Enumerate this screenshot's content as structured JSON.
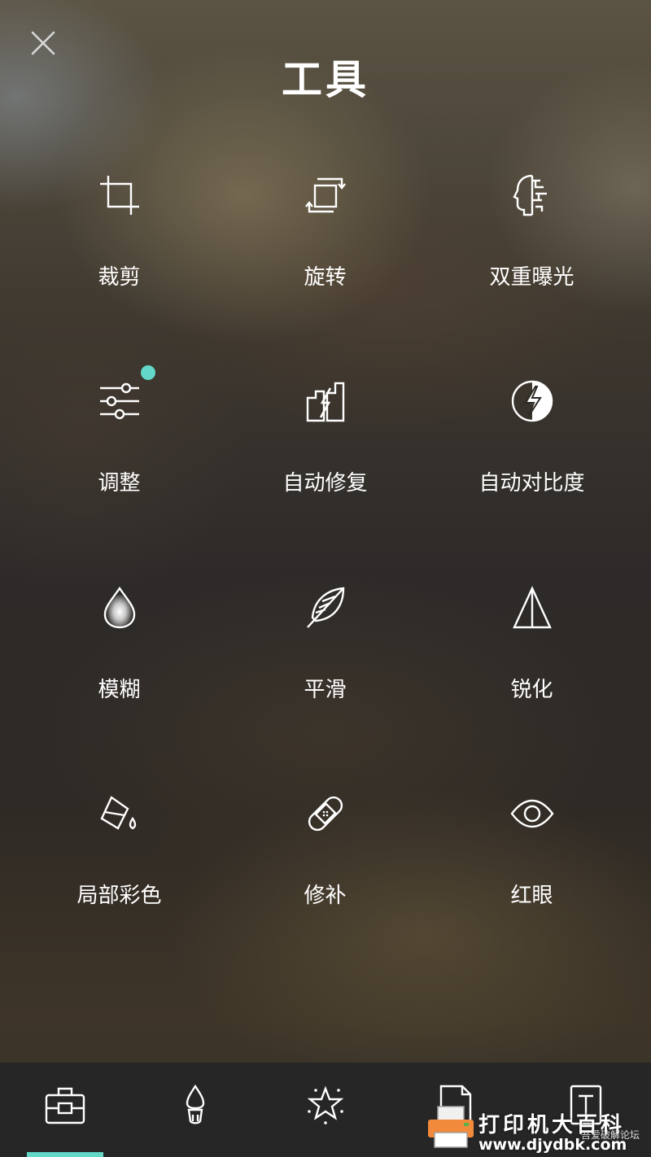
{
  "header": {
    "close_icon": "close-icon",
    "title": "工具"
  },
  "tools": [
    {
      "label": "裁剪",
      "icon": "crop-icon"
    },
    {
      "label": "旋转",
      "icon": "rotate-icon"
    },
    {
      "label": "双重曝光",
      "icon": "double-exposure-icon"
    },
    {
      "label": "调整",
      "icon": "tune-sliders-icon",
      "has_badge": true
    },
    {
      "label": "自动修复",
      "icon": "auto-fix-icon"
    },
    {
      "label": "自动对比度",
      "icon": "auto-contrast-icon"
    },
    {
      "label": "模糊",
      "icon": "blur-drop-icon"
    },
    {
      "label": "平滑",
      "icon": "feather-icon"
    },
    {
      "label": "锐化",
      "icon": "sharpen-triangle-icon"
    },
    {
      "label": "局部彩色",
      "icon": "paint-bucket-icon"
    },
    {
      "label": "修补",
      "icon": "bandage-icon"
    },
    {
      "label": "红眼",
      "icon": "eye-icon"
    }
  ],
  "bottom_tabs": [
    {
      "icon": "toolbox-icon",
      "active": true
    },
    {
      "icon": "brush-icon"
    },
    {
      "icon": "sticker-star-icon"
    },
    {
      "icon": "frame-document-icon"
    },
    {
      "icon": "text-icon"
    }
  ],
  "watermark": {
    "main": "打印机大百科",
    "url": "www.djydbk.com",
    "sub": "吾爱破解论坛"
  },
  "colors": {
    "accent": "#64d8c8",
    "bottom_bar": "#262626",
    "text": "#ffffff"
  }
}
